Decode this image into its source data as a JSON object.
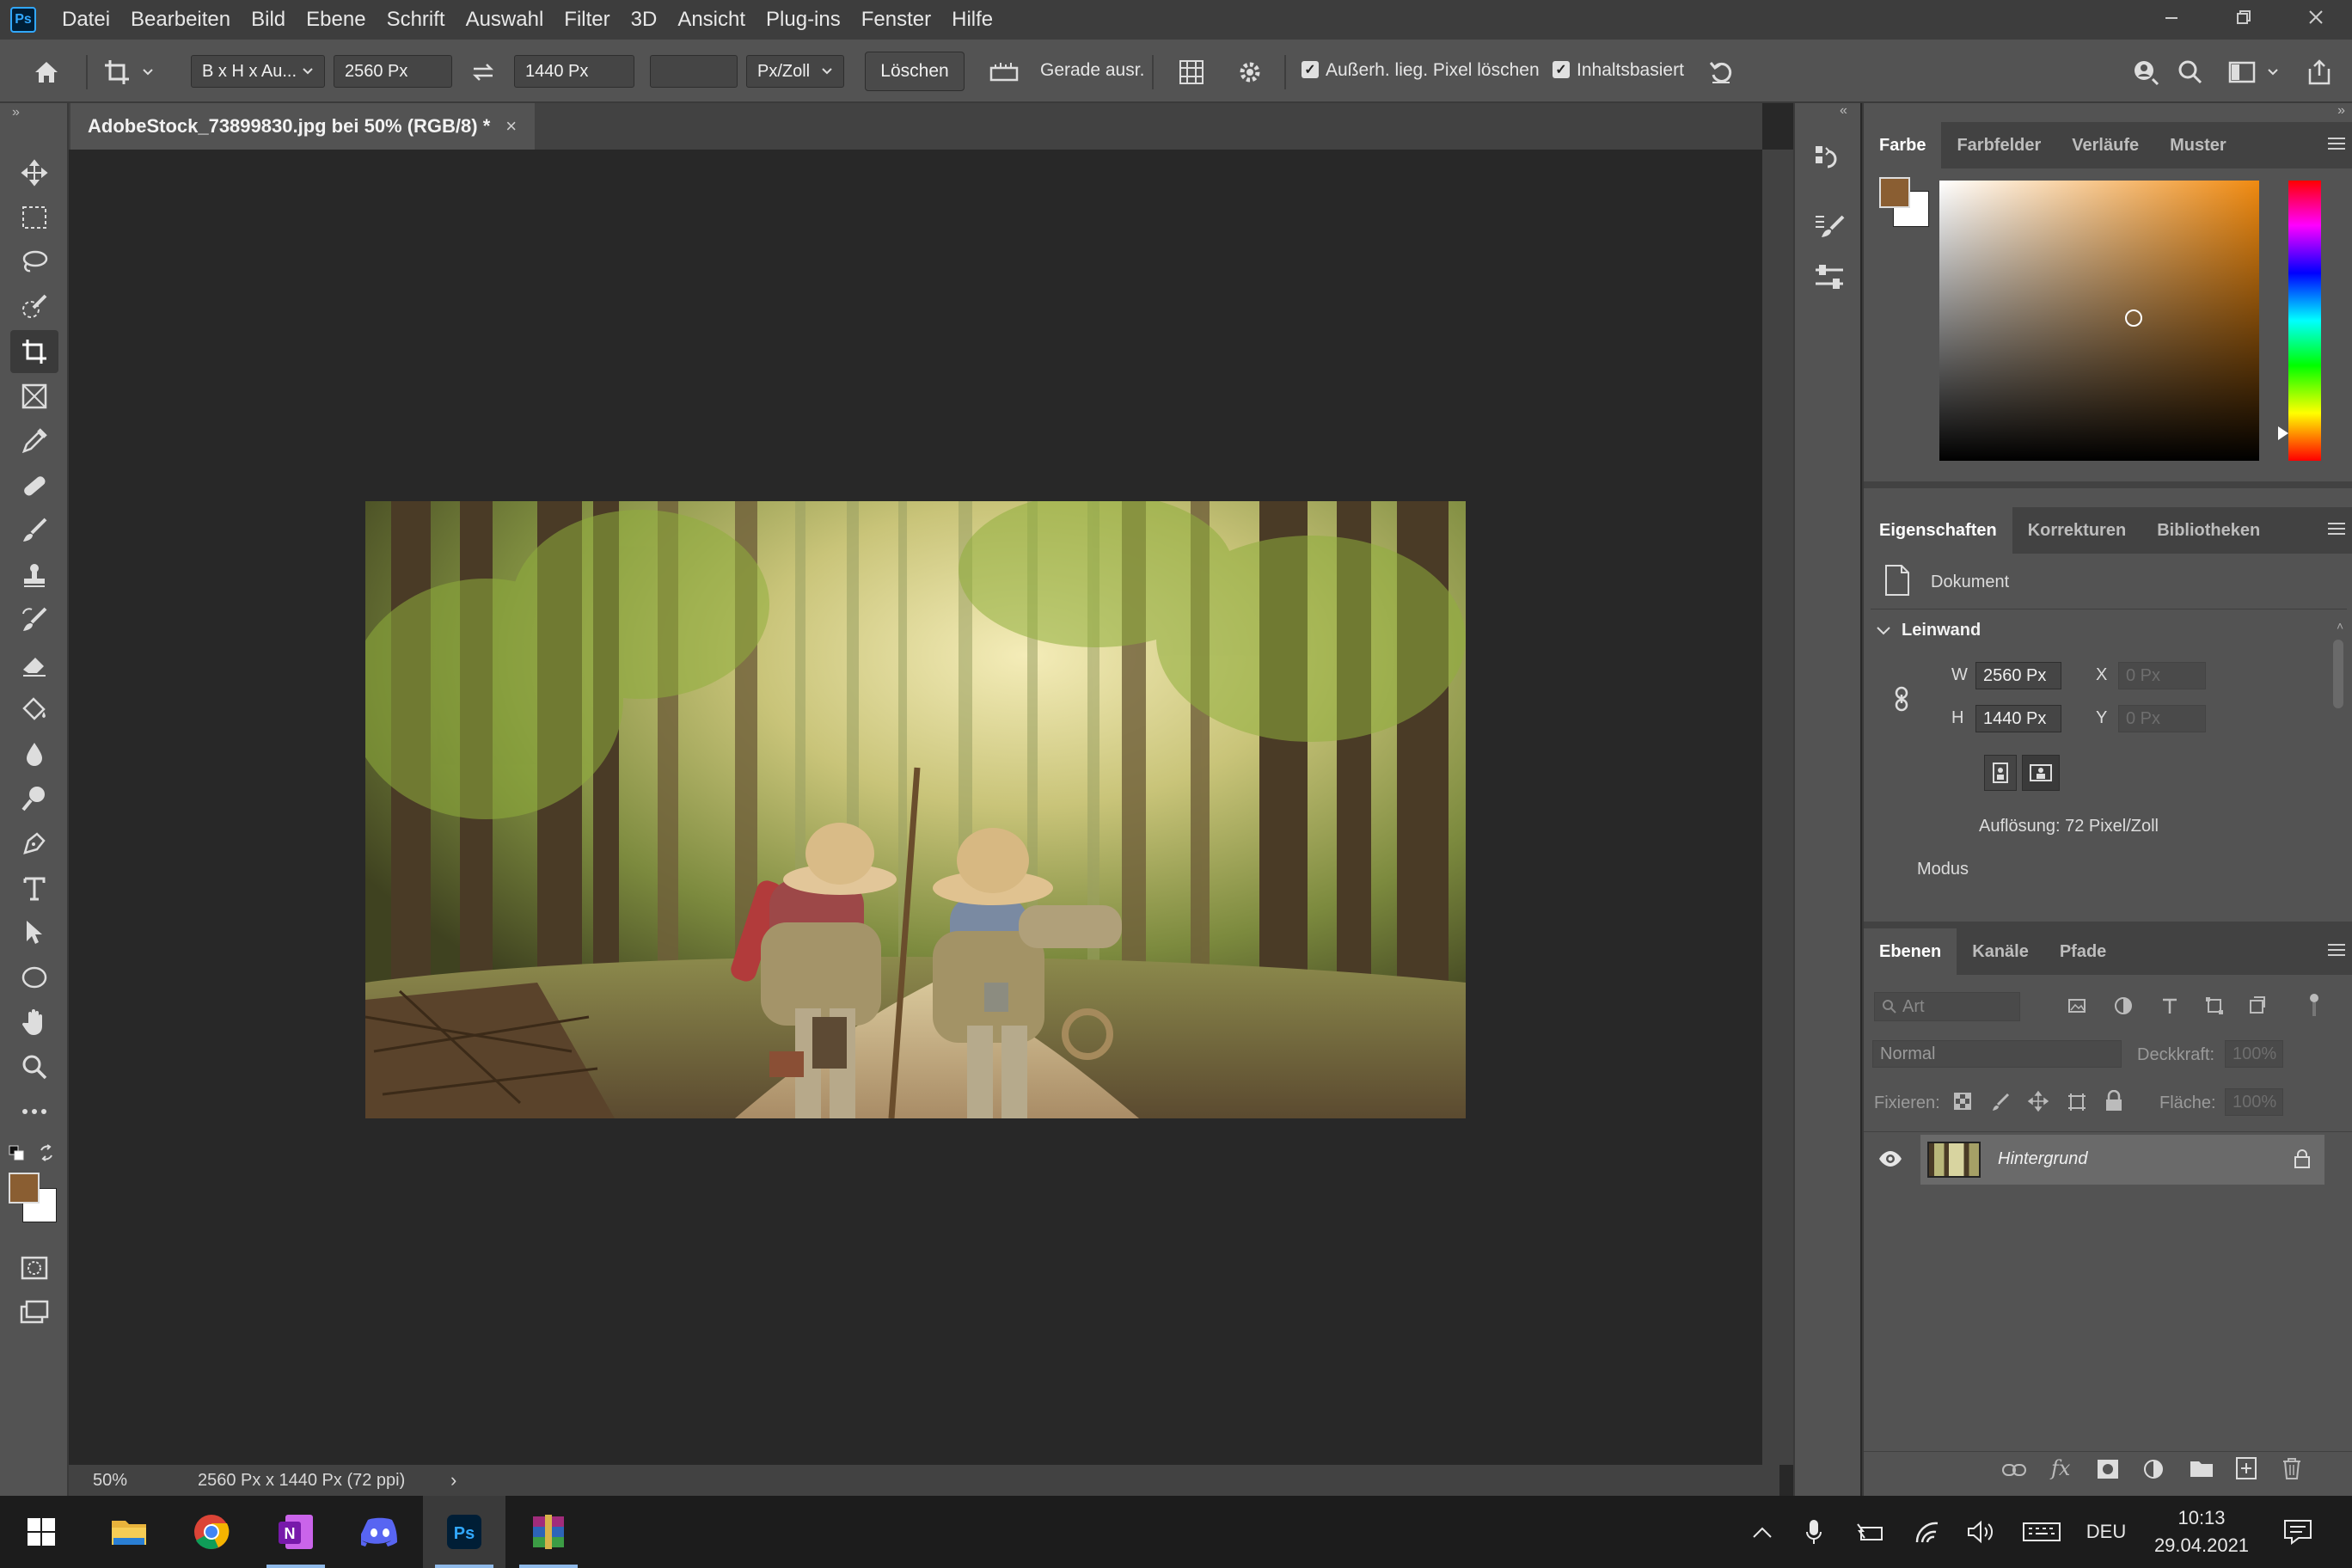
{
  "app": {
    "logo": "Ps"
  },
  "menu": [
    "Datei",
    "Bearbeiten",
    "Bild",
    "Ebene",
    "Schrift",
    "Auswahl",
    "Filter",
    "3D",
    "Ansicht",
    "Plug-ins",
    "Fenster",
    "Hilfe"
  ],
  "options": {
    "ratio_preset": "B x H x Au...",
    "width": "2560 Px",
    "height": "1440 Px",
    "resolution": "",
    "unit": "Px/Zoll",
    "clear_button": "Löschen",
    "straighten_label": "Gerade ausr.",
    "delete_cropped_label": "Außerh. lieg. Pixel löschen",
    "delete_cropped_checked": true,
    "content_aware_label": "Inhaltsbasiert",
    "content_aware_checked": true
  },
  "document": {
    "tab_title": "AdobeStock_73899830.jpg bei 50% (RGB/8) *",
    "tab_close": "×",
    "zoom": "50%",
    "status": "2560 Px x 1440 Px (72 ppi)",
    "status_arrow": "›"
  },
  "colors": {
    "foreground": "#8a5e32",
    "background": "#ffffff",
    "picker_hue": "#f08a10"
  },
  "color_panel": {
    "tabs": [
      "Farbe",
      "Farbfelder",
      "Verläufe",
      "Muster"
    ]
  },
  "properties_panel": {
    "tabs": [
      "Eigenschaften",
      "Korrekturen",
      "Bibliotheken"
    ],
    "doc_label": "Dokument",
    "section": "Leinwand",
    "w_label": "W",
    "w_value": "2560 Px",
    "h_label": "H",
    "h_value": "1440 Px",
    "x_label": "X",
    "x_placeholder": "0 Px",
    "y_label": "Y",
    "y_placeholder": "0 Px",
    "resolution": "Auflösung: 72 Pixel/Zoll",
    "mode_label": "Modus"
  },
  "layers_panel": {
    "tabs": [
      "Ebenen",
      "Kanäle",
      "Pfade"
    ],
    "filter_placeholder": "Art",
    "blend_mode": "Normal",
    "opacity_label": "Deckkraft:",
    "opacity": "100%",
    "lock_label": "Fixieren:",
    "fill_label": "Fläche:",
    "fill": "100%",
    "layers": [
      {
        "name": "Hintergrund",
        "visible": true,
        "locked": true
      }
    ]
  },
  "taskbar": {
    "language": "DEU",
    "time": "10:13",
    "date": "29.04.2021"
  }
}
